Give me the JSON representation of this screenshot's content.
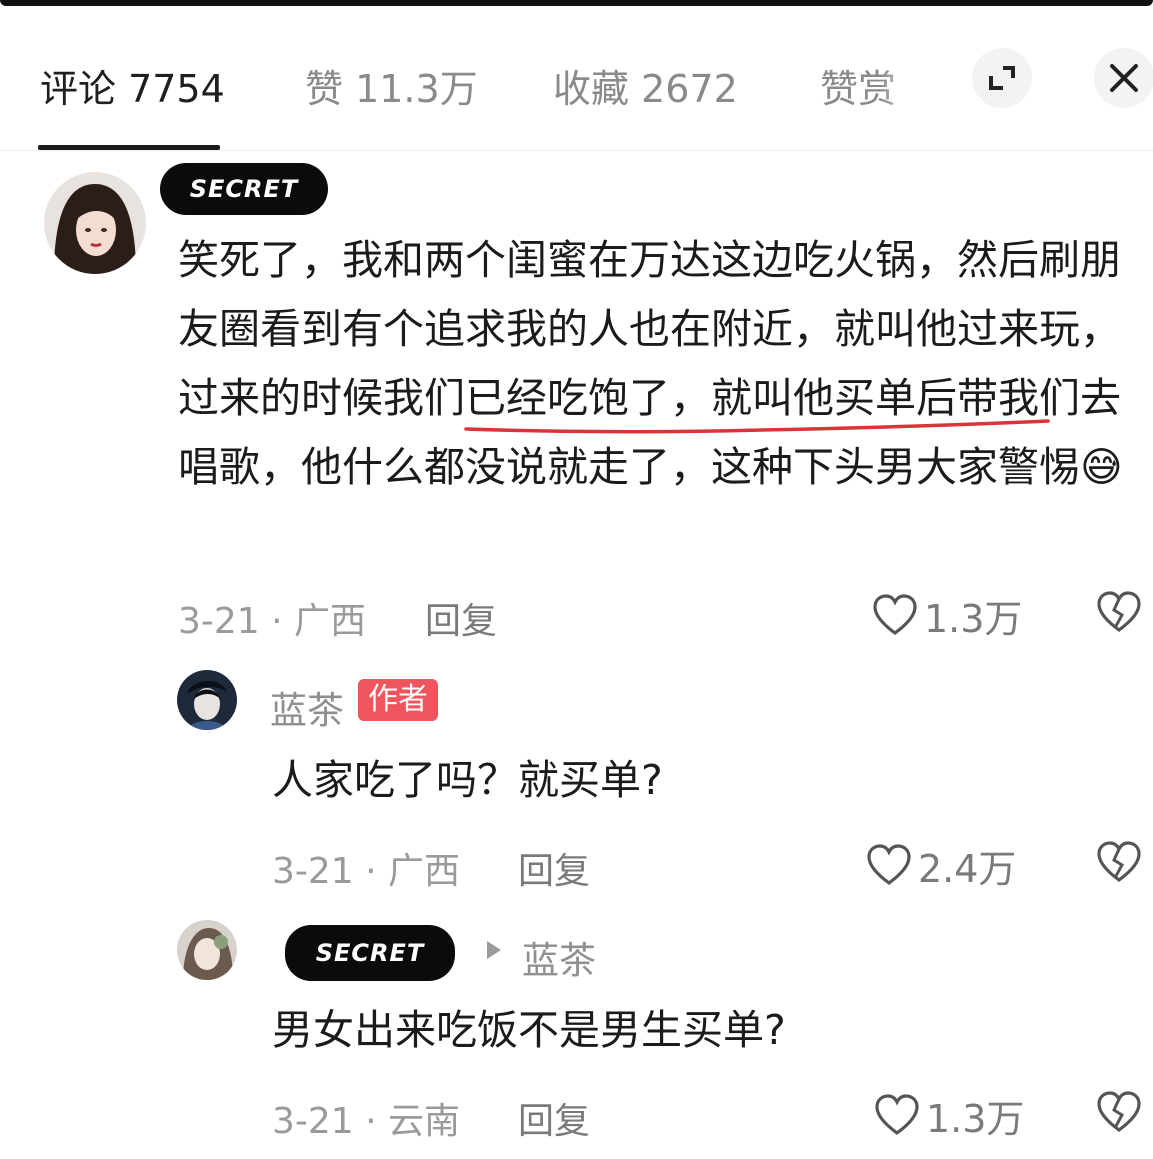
{
  "tabs": {
    "comments": "评论 7754",
    "likes": "赞 11.3万",
    "favorites": "收藏 2672",
    "rewards": "赞赏"
  },
  "icons": {
    "expand": "expand-icon",
    "close": "close-icon"
  },
  "comments": [
    {
      "redacted_label": "SECRET",
      "text": "笑死了，我和两个闺蜜在万达这边吃火锅，然后刷朋友圈看到有个追求我的人也在附近，就叫他过来玩，过来的时候我们已经吃饱了，就叫他买单后带我们去唱歌，他什么都没说就走了，这种下头男大家警惕",
      "emoji": "😅",
      "date_location": "3-21 · 广西",
      "reply": "回复",
      "likes": "1.3万"
    },
    {
      "author": "蓝茶",
      "badge": "作者",
      "text": "人家吃了吗？就买单?",
      "date_location": "3-21 · 广西",
      "reply": "回复",
      "likes": "2.4万"
    },
    {
      "redacted_label": "SECRET",
      "reply_to": "蓝茶",
      "text": "男女出来吃饭不是男生买单?",
      "date_location": "3-21 · 云南",
      "reply": "回复",
      "likes": "1.3万"
    }
  ],
  "colors": {
    "badge": "#f0555d",
    "highlight_underline": "#d9343a"
  }
}
